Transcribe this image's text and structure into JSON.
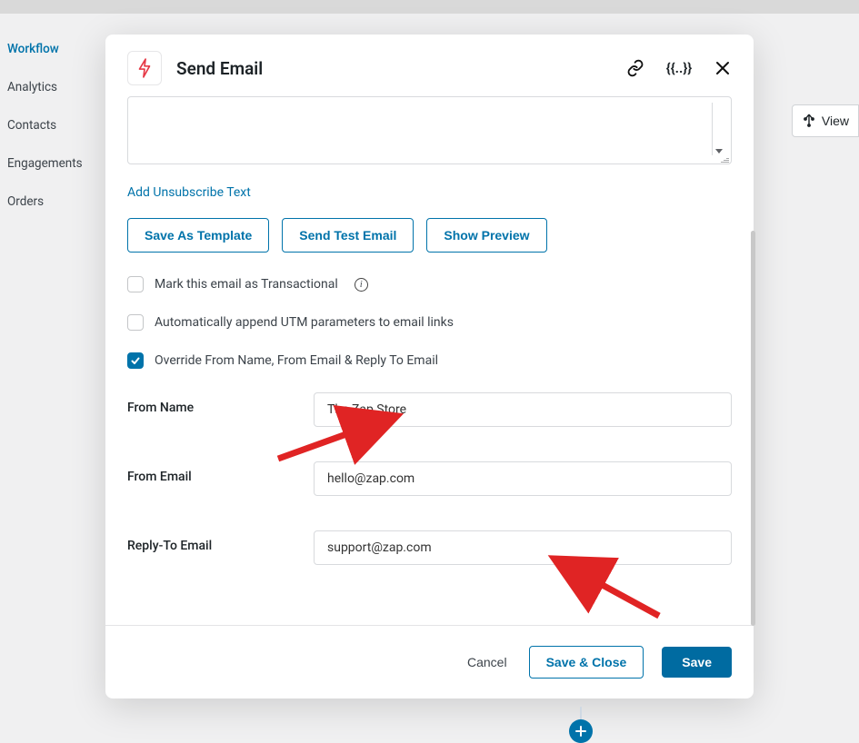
{
  "sidebar": {
    "items": [
      {
        "label": "Workflow",
        "active": true
      },
      {
        "label": "Analytics",
        "active": false
      },
      {
        "label": "Contacts",
        "active": false
      },
      {
        "label": "Engagements",
        "active": false
      },
      {
        "label": "Orders",
        "active": false
      }
    ]
  },
  "toolbar": {
    "view": "View"
  },
  "modal": {
    "title": "Send Email",
    "links": {
      "add_unsubscribe": "Add Unsubscribe Text"
    },
    "buttons": {
      "save_template": "Save As Template",
      "send_test": "Send Test Email",
      "show_preview": "Show Preview"
    },
    "checkboxes": {
      "transactional": "Mark this email as Transactional",
      "utm": "Automatically append UTM parameters to email links",
      "override": "Override From Name, From Email & Reply To Email"
    },
    "fields": {
      "from_name": {
        "label": "From Name",
        "value": "The Zap Store"
      },
      "from_email": {
        "label": "From Email",
        "value": "hello@zap.com"
      },
      "reply_to": {
        "label": "Reply-To Email",
        "value": "support@zap.com"
      }
    },
    "footer": {
      "cancel": "Cancel",
      "save_close": "Save & Close",
      "save": "Save"
    }
  }
}
